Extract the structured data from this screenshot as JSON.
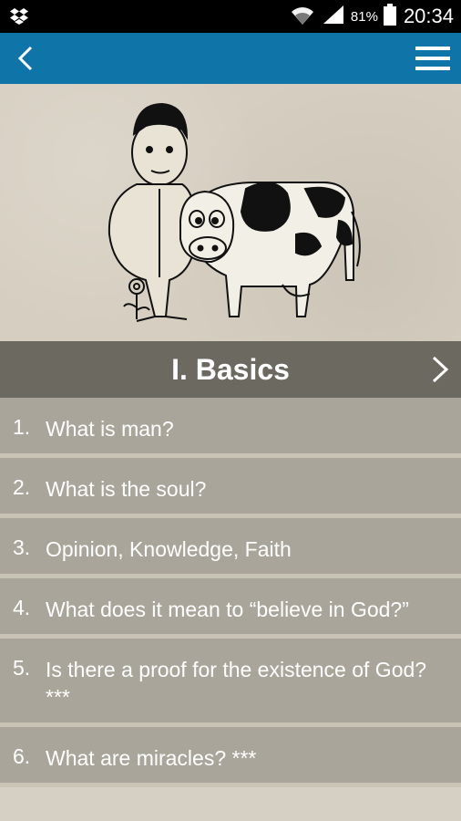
{
  "status_bar": {
    "battery_percent": "81%",
    "time": "20:34",
    "icons": [
      "dropbox-icon",
      "wifi-icon",
      "signal-icon",
      "battery-icon"
    ]
  },
  "app_bar": {
    "icons": [
      "back-arrow-icon",
      "hamburger-menu-icon"
    ],
    "color": "#0f75a8"
  },
  "hero": {
    "illustration": "man-and-cow-cartoon"
  },
  "section": {
    "title": "I. Basics",
    "header_color": "#6c6961"
  },
  "items": [
    {
      "num": "1.",
      "text": "What is man?"
    },
    {
      "num": "2.",
      "text": "What is the soul?"
    },
    {
      "num": "3.",
      "text": "Opinion, Knowledge, Faith"
    },
    {
      "num": "4.",
      "text": "What does it mean to “believe in God?”"
    },
    {
      "num": "5.",
      "text": "Is there a proof for the existence of God? ***"
    },
    {
      "num": "6.",
      "text": "What are miracles? ***"
    }
  ]
}
